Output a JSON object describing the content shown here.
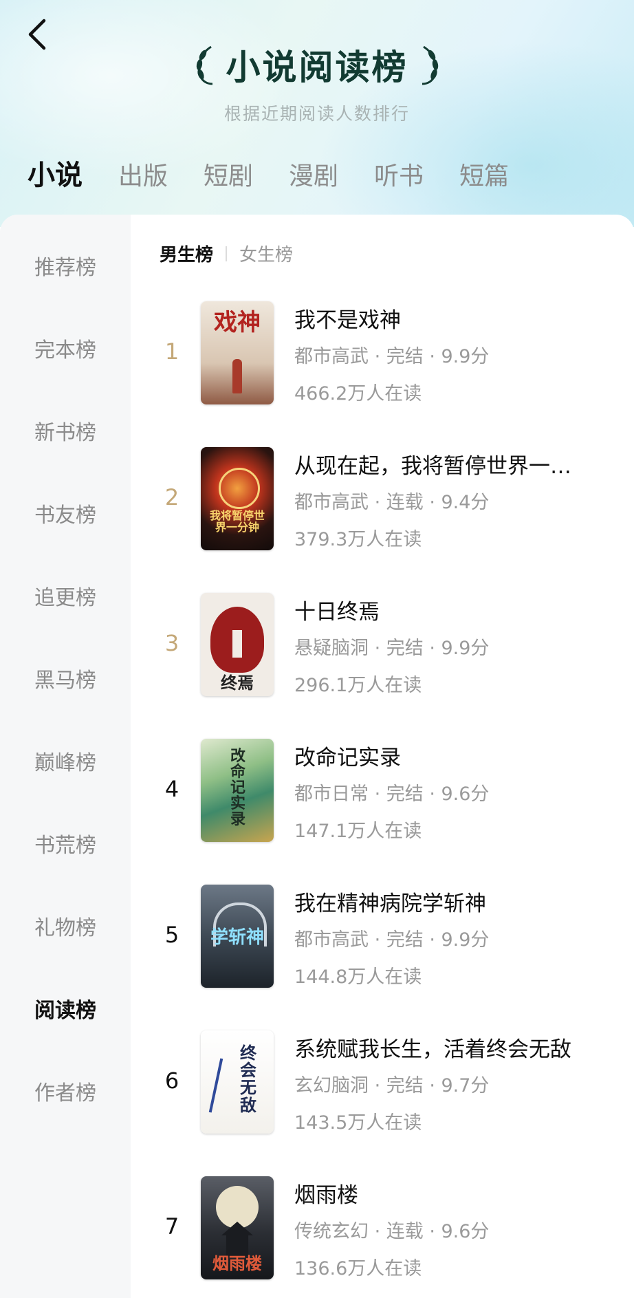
{
  "header": {
    "title": "小说阅读榜",
    "subtitle": "根据近期阅读人数排行"
  },
  "category_tabs": [
    {
      "label": "小说",
      "active": true
    },
    {
      "label": "出版",
      "active": false
    },
    {
      "label": "短剧",
      "active": false
    },
    {
      "label": "漫剧",
      "active": false
    },
    {
      "label": "听书",
      "active": false
    },
    {
      "label": "短篇",
      "active": false
    }
  ],
  "sidebar": {
    "items": [
      {
        "label": "推荐榜",
        "active": false
      },
      {
        "label": "完本榜",
        "active": false
      },
      {
        "label": "新书榜",
        "active": false
      },
      {
        "label": "书友榜",
        "active": false
      },
      {
        "label": "追更榜",
        "active": false
      },
      {
        "label": "黑马榜",
        "active": false
      },
      {
        "label": "巅峰榜",
        "active": false
      },
      {
        "label": "书荒榜",
        "active": false
      },
      {
        "label": "礼物榜",
        "active": false
      },
      {
        "label": "阅读榜",
        "active": true
      },
      {
        "label": "作者榜",
        "active": false
      }
    ]
  },
  "gender_tabs": [
    {
      "label": "男生榜",
      "active": true
    },
    {
      "label": "女生榜",
      "active": false
    }
  ],
  "books": [
    {
      "rank": "1",
      "title": "我不是戏神",
      "meta": "都市高武 · 完结 · 9.9分",
      "readers": "466.2万人在读",
      "cover_text": "戏神"
    },
    {
      "rank": "2",
      "title": "从现在起，我将暂停世界一…",
      "meta": "都市高武 · 连载 · 9.4分",
      "readers": "379.3万人在读",
      "cover_text": "我将暂停世界一分钟"
    },
    {
      "rank": "3",
      "title": "十日终焉",
      "meta": "悬疑脑洞 · 完结 · 9.9分",
      "readers": "296.1万人在读",
      "cover_text": "终焉"
    },
    {
      "rank": "4",
      "title": "改命记实录",
      "meta": "都市日常 · 完结 · 9.6分",
      "readers": "147.1万人在读",
      "cover_text": "改命记实录"
    },
    {
      "rank": "5",
      "title": "我在精神病院学斩神",
      "meta": "都市高武 · 完结 · 9.9分",
      "readers": "144.8万人在读",
      "cover_text": "学斩神"
    },
    {
      "rank": "6",
      "title": "系统赋我长生，活着终会无敌",
      "meta": "玄幻脑洞 · 完结 · 9.7分",
      "readers": "143.5万人在读",
      "cover_text": "终会无敌"
    },
    {
      "rank": "7",
      "title": "烟雨楼",
      "meta": "传统玄幻 · 连载 · 9.6分",
      "readers": "136.6万人在读",
      "cover_text": "烟雨楼"
    }
  ],
  "colors": {
    "accent_rank": "#c4a878",
    "title": "#123b32"
  }
}
